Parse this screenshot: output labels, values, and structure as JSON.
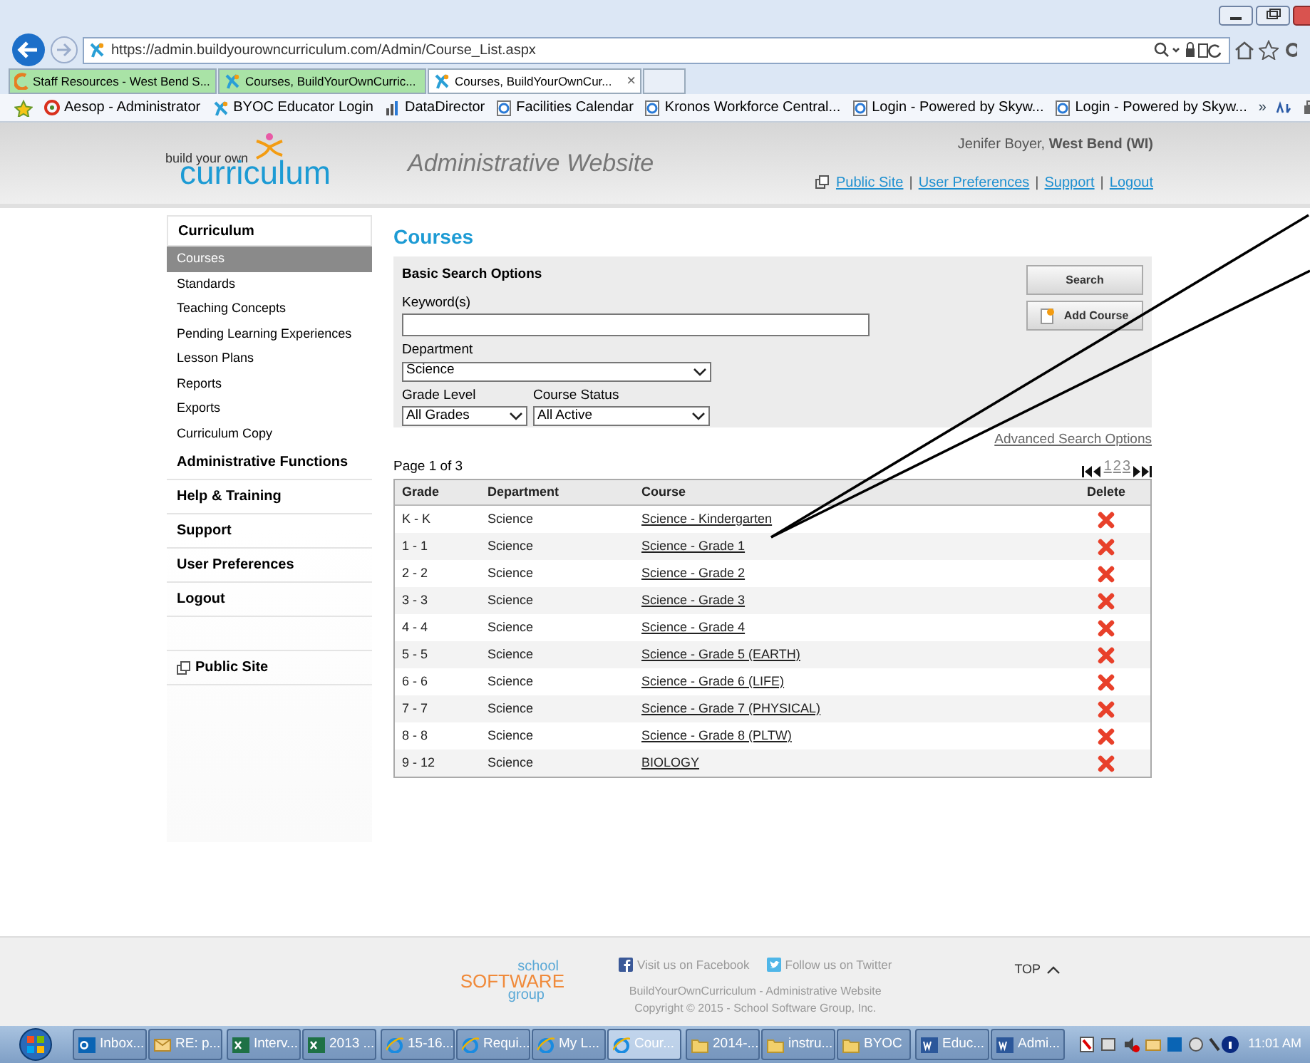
{
  "browser": {
    "url": "https://admin.buildyourowncurriculum.com/Admin/Course_List.aspx",
    "tabs": [
      {
        "label": "Staff Resources - West Bend S...",
        "selected": false,
        "kind": "school"
      },
      {
        "label": "Courses, BuildYourOwnCurric...",
        "selected": false,
        "kind": "byoc"
      },
      {
        "label": "Courses, BuildYourOwnCur...",
        "selected": true,
        "kind": "byoc",
        "close": "×"
      }
    ],
    "favorites": [
      {
        "label": "Aesop - Administrator",
        "kind": "aesop"
      },
      {
        "label": "BYOC Educator Login",
        "kind": "byoc"
      },
      {
        "label": "DataDirector",
        "kind": "bars"
      },
      {
        "label": "Facilities Calendar",
        "kind": "page"
      },
      {
        "label": "Kronos Workforce Central...",
        "kind": "page"
      },
      {
        "label": "Login - Powered by Skyw...",
        "kind": "page"
      },
      {
        "label": "Login - Powered by Skyw...",
        "kind": "page"
      }
    ],
    "chevron": "»"
  },
  "header": {
    "logo_small": "build your own",
    "logo_big": "curriculum",
    "site_title": "Administrative Website",
    "user": "Jenifer Boyer, **West Bend (WI)**",
    "links": [
      "Public Site",
      "User Preferences",
      "Support",
      "Logout"
    ],
    "separator": "|"
  },
  "sidebar": {
    "heading": "Curriculum",
    "items": [
      {
        "label": "Courses",
        "selected": true
      },
      {
        "label": "Standards",
        "selected": false
      },
      {
        "label": "Teaching Concepts",
        "selected": false
      },
      {
        "label": "Pending Learning Experiences",
        "selected": false
      },
      {
        "label": "Lesson Plans",
        "selected": false
      },
      {
        "label": "Reports",
        "selected": false
      },
      {
        "label": "Exports",
        "selected": false
      },
      {
        "label": "Curriculum Copy",
        "selected": false
      }
    ],
    "sections": [
      "Administrative Functions",
      "Help & Training",
      "Support",
      "User Preferences",
      "Logout"
    ],
    "public_site": "Public Site"
  },
  "page_title": "Courses",
  "search": {
    "title": "Basic Search Options",
    "keyword_label": "Keyword(s)",
    "department_label": "Department",
    "department": "Science",
    "grade_label": "Grade Level",
    "grade": "All Grades",
    "status_label": "Course Status",
    "status": "All Active",
    "search_button": "Search",
    "add_button": "Add Course",
    "advanced_link": "Advanced Search Options"
  },
  "pager": {
    "summary": "Page 1 of 3",
    "pages": [
      "1",
      "2",
      "3"
    ]
  },
  "table": {
    "columns": [
      "Grade",
      "Department",
      "Course",
      "Delete"
    ],
    "rows": [
      {
        "grade": "K - K",
        "department": "Science",
        "course": "Science - Kindergarten"
      },
      {
        "grade": "1 - 1",
        "department": "Science",
        "course": "Science - Grade 1"
      },
      {
        "grade": "2 - 2",
        "department": "Science",
        "course": "Science - Grade 2"
      },
      {
        "grade": "3 - 3",
        "department": "Science",
        "course": "Science - Grade 3"
      },
      {
        "grade": "4 - 4",
        "department": "Science",
        "course": "Science - Grade 4"
      },
      {
        "grade": "5 - 5",
        "department": "Science",
        "course": "Science - Grade 5 (EARTH)"
      },
      {
        "grade": "6 - 6",
        "department": "Science",
        "course": "Science - Grade 6 (LIFE)"
      },
      {
        "grade": "7 - 7",
        "department": "Science",
        "course": "Science - Grade 7 (PHYSICAL)"
      },
      {
        "grade": "8 - 8",
        "department": "Science",
        "course": "Science - Grade 8 (PLTW)"
      },
      {
        "grade": "9 - 12",
        "department": "Science",
        "course": "BIOLOGY"
      }
    ]
  },
  "footer": {
    "logo": [
      "school",
      "SOFTWARE",
      "group"
    ],
    "facebook": "Visit us on Facebook",
    "twitter": "Follow us on Twitter",
    "line1": "BuildYourOwnCurriculum - Administrative Website",
    "line2": "Copyright © 2015 - School Software Group, Inc.",
    "top": "TOP"
  },
  "taskbar": {
    "groups": [
      [
        {
          "label": "Inbox...",
          "kind": "outlook",
          "selected": false
        },
        {
          "label": "RE: p...",
          "kind": "mail",
          "selected": false
        }
      ],
      [
        {
          "label": "Interv...",
          "kind": "excel",
          "selected": false
        },
        {
          "label": "2013 ...",
          "kind": "excel",
          "selected": false
        }
      ],
      [
        {
          "label": "15-16...",
          "kind": "ie",
          "selected": false
        },
        {
          "label": "Requi...",
          "kind": "ie",
          "selected": false
        },
        {
          "label": "My L...",
          "kind": "ie",
          "selected": false
        },
        {
          "label": "Cour...",
          "kind": "ie",
          "selected": true
        }
      ],
      [
        {
          "label": "2014-...",
          "kind": "folder",
          "selected": false
        },
        {
          "label": "instru...",
          "kind": "folder",
          "selected": false
        },
        {
          "label": "BYOC",
          "kind": "folder",
          "selected": false
        }
      ],
      [
        {
          "label": "Educ...",
          "kind": "word",
          "selected": false
        },
        {
          "label": "Admi...",
          "kind": "word",
          "selected": false
        }
      ]
    ],
    "clock": "11:01 AM"
  }
}
